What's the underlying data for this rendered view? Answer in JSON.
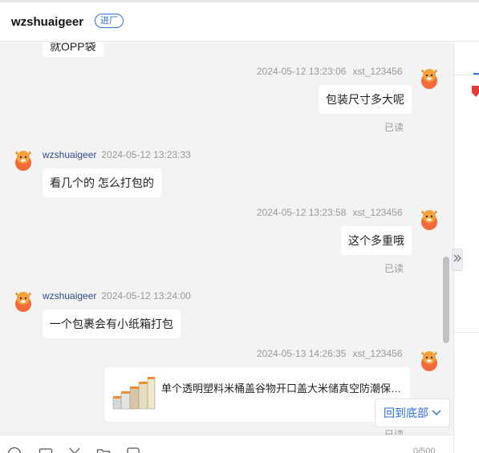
{
  "header": {
    "contact_name": "wzshuaigeer",
    "tag_label": "进厂"
  },
  "messages": [
    {
      "side": "left",
      "text": "就OPP袋",
      "partial": true
    },
    {
      "side": "right",
      "time": "2024-05-12 13:23:06",
      "user": "xst_123456",
      "text": "包装尺寸多大呢",
      "status": "已读"
    },
    {
      "side": "left",
      "user": "wzshuaigeer",
      "time": "2024-05-12 13:23:33",
      "text": "看几个的 怎么打包的"
    },
    {
      "side": "right",
      "time": "2024-05-12 13:23:58",
      "user": "xst_123456",
      "text": "这个多重哦",
      "status": "已读"
    },
    {
      "side": "left",
      "user": "wzshuaigeer",
      "time": "2024-05-12 13:24:00",
      "text": "一个包裹会有小纸箱打包"
    },
    {
      "side": "right",
      "time": "2024-05-13 14:26:35",
      "user": "xst_123456",
      "product_title": "单个透明塑料米桶盖谷物开口盖大米储真空防潮保鲜收...",
      "status": "已读"
    }
  ],
  "scroll_to_bottom_label": "回到底部",
  "toolbar": {
    "icons": [
      "emoji-icon",
      "image-icon",
      "scissors-icon",
      "folder-icon",
      "history-icon"
    ],
    "char_count": "0/500"
  },
  "colors": {
    "accent": "#2f6fd6",
    "chat_bg": "#f3f3f3",
    "username": "#2f4b8a"
  }
}
